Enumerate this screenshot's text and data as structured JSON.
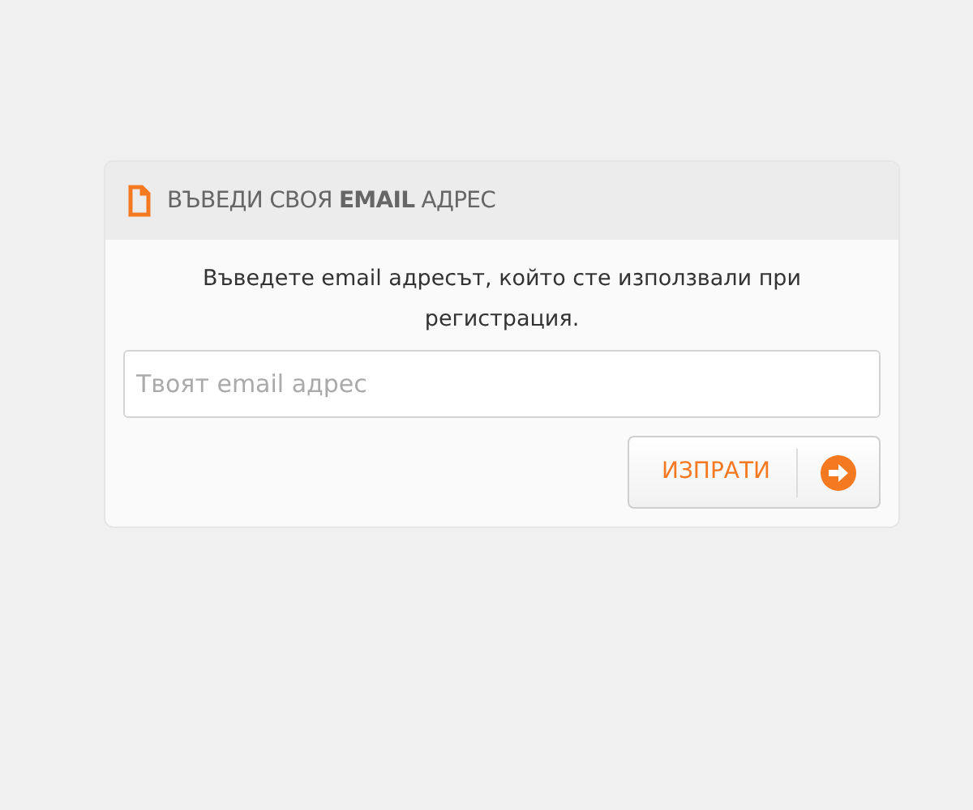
{
  "panel": {
    "title": "ВЪВЕДИ СВОЯ **EMAIL** АДРЕС",
    "instructions": "Въведете email адресът, който сте използвали при регистрация.",
    "email_field": {
      "placeholder": "Твоят email адрес"
    },
    "submit_button": {
      "label": "ИЗПРАТИ"
    }
  }
}
